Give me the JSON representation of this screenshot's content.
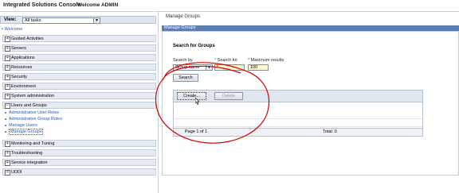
{
  "header": {
    "app_title": "Integrated Solutions Console",
    "welcome": "Welcome ADMIN"
  },
  "nav": {
    "view_label": "View:",
    "view_value": "All tasks",
    "welcome_link": "Welcome",
    "items": [
      {
        "label": "Guided Activities"
      },
      {
        "label": "Servers"
      },
      {
        "label": "Applications"
      },
      {
        "label": "Resources"
      },
      {
        "label": "Security"
      },
      {
        "label": "Environment"
      },
      {
        "label": "System administration"
      },
      {
        "label": "Users and Groups"
      },
      {
        "label": "Monitoring and Tuning"
      },
      {
        "label": "Troubleshooting"
      },
      {
        "label": "Service integration"
      },
      {
        "label": "UDDI"
      }
    ],
    "users_groups_sub": [
      {
        "label": "Administrative User Roles"
      },
      {
        "label": "Administrative Group Roles"
      },
      {
        "label": "Manage Users"
      },
      {
        "label": "Manage Groups"
      }
    ]
  },
  "main": {
    "breadcrumb": "Manage Groups",
    "panel_title": "Manage Groups",
    "section_title": "Search for Groups",
    "search_by_label": "Search by",
    "search_by_value": "Group name",
    "search_for_label": "Search for",
    "search_for_value": "*",
    "max_results_label": "Maximum results",
    "max_results_value": "100",
    "search_button": "Search",
    "create_button": "Create...",
    "delete_button": "Delete",
    "page_label": "Page 1 of 1",
    "total_label": "Total: 0"
  },
  "colors": {
    "panel_bar": "#5c7fb0",
    "annotation_circle": "#d40000",
    "link": "#2a58a8"
  }
}
